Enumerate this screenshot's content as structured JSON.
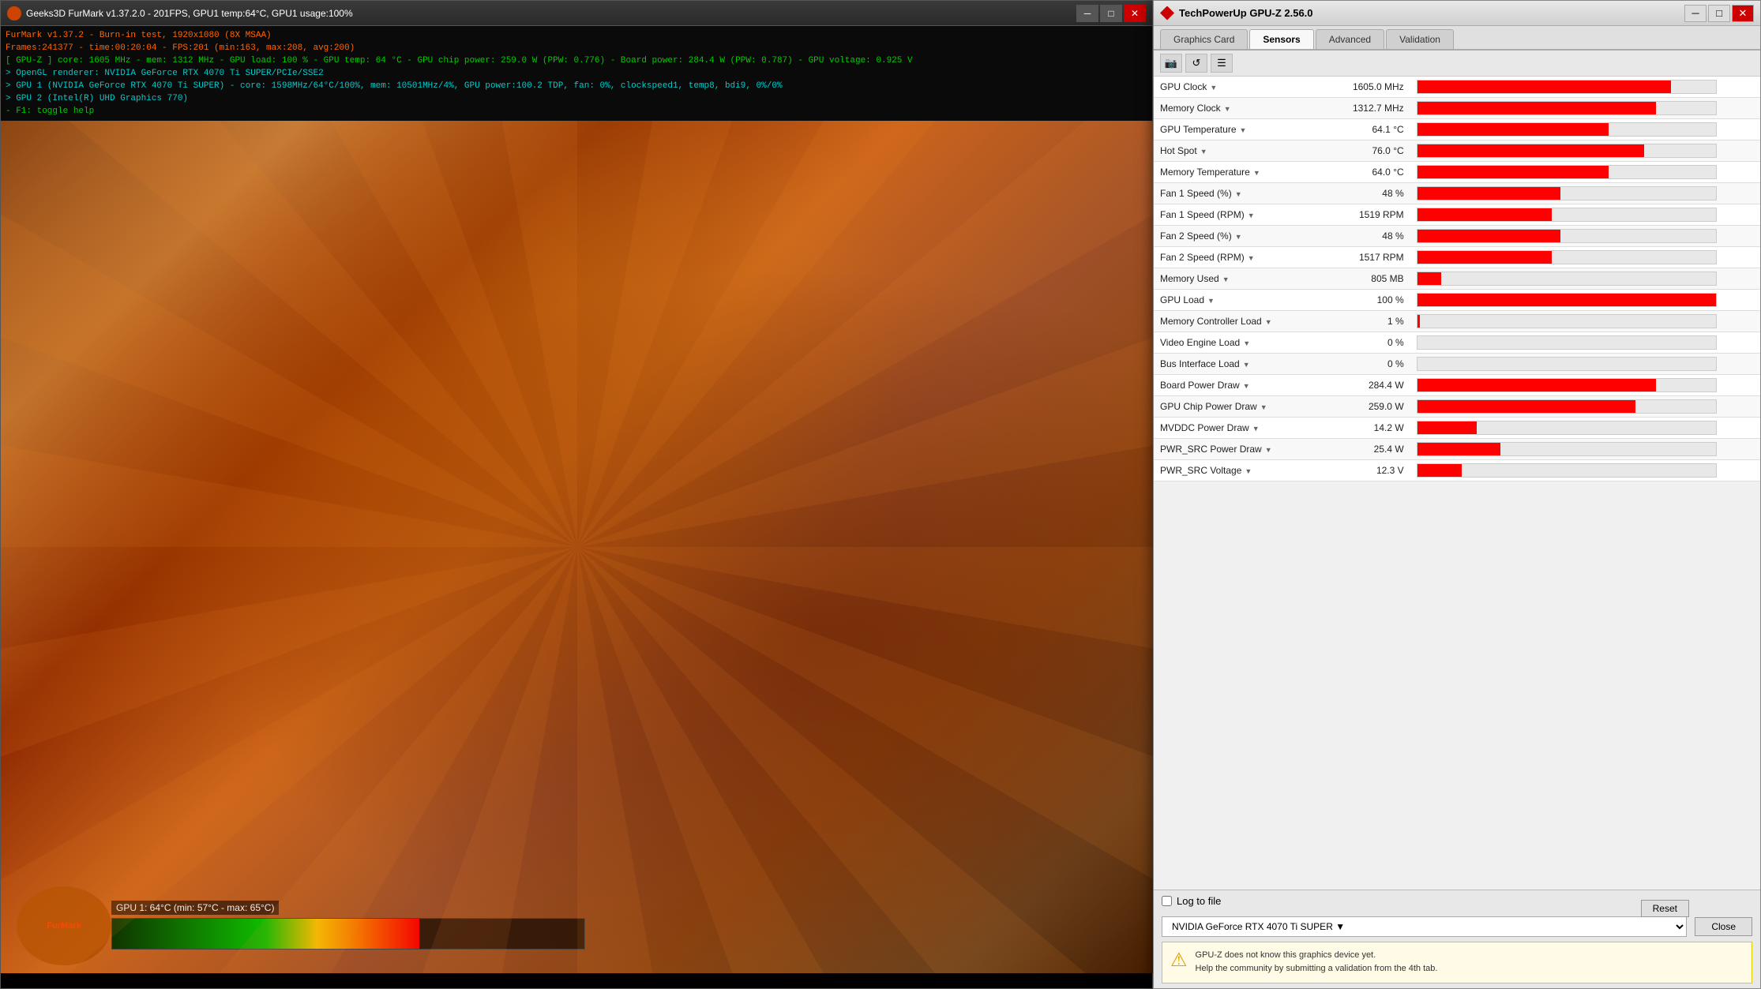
{
  "furmark": {
    "titlebar": {
      "title": "Geeks3D FurMark v1.37.2.0 - 201FPS, GPU1 temp:64°C, GPU1 usage:100%"
    },
    "info_lines": [
      "FurMark v1.37.2 - Burn-in test, 1920x1080 (8X MSAA)",
      "Frames:241377 - time:00:20:04 - FPS:201 (min:163, max:208, avg:200)",
      "[ GPU-Z ] core: 1605 MHz - mem: 1312 MHz - GPU load: 100 % - GPU temp: 64 °C - GPU chip power: 259.0 W (PPW: 0.776) - Board power: 284.4 W (PPW: 0.787) - GPU voltage: 0.925 V",
      "> OpenGL renderer: NVIDIA GeForce RTX 4070 Ti SUPER/PCIe/SSE2",
      "> GPU 1 (NVIDIA GeForce RTX 4070 Ti SUPER) - core: 1598MHz/64°C/100%, mem: 10501MHz/4%, GPU power:100.2 TDP, fan: 0%, clockspeed1, temp8, bdi9, 0%/0%",
      "> GPU 2 (Intel(R) UHD Graphics 770)",
      "- F1: toggle help"
    ],
    "overlay": {
      "temp_label": "GPU 1: 64°C (min: 57°C - max: 65°C)"
    }
  },
  "gpuz": {
    "titlebar": {
      "title": "TechPowerUp GPU-Z 2.56.0"
    },
    "tabs": [
      {
        "label": "Graphics Card",
        "active": false
      },
      {
        "label": "Sensors",
        "active": true
      },
      {
        "label": "Advanced",
        "active": false
      },
      {
        "label": "Validation",
        "active": false
      }
    ],
    "toolbar": {
      "icons": [
        "camera",
        "refresh",
        "menu"
      ]
    },
    "sensors": [
      {
        "name": "GPU Clock",
        "value": "1605.0 MHz",
        "bar_pct": 85
      },
      {
        "name": "Memory Clock",
        "value": "1312.7 MHz",
        "bar_pct": 80
      },
      {
        "name": "GPU Temperature",
        "value": "64.1 °C",
        "bar_pct": 64
      },
      {
        "name": "Hot Spot",
        "value": "76.0 °C",
        "bar_pct": 76
      },
      {
        "name": "Memory Temperature",
        "value": "64.0 °C",
        "bar_pct": 64
      },
      {
        "name": "Fan 1 Speed (%)",
        "value": "48 %",
        "bar_pct": 48
      },
      {
        "name": "Fan 1 Speed (RPM)",
        "value": "1519 RPM",
        "bar_pct": 45
      },
      {
        "name": "Fan 2 Speed (%)",
        "value": "48 %",
        "bar_pct": 48
      },
      {
        "name": "Fan 2 Speed (RPM)",
        "value": "1517 RPM",
        "bar_pct": 45
      },
      {
        "name": "Memory Used",
        "value": "805 MB",
        "bar_pct": 8
      },
      {
        "name": "GPU Load",
        "value": "100 %",
        "bar_pct": 100
      },
      {
        "name": "Memory Controller Load",
        "value": "1 %",
        "bar_pct": 1
      },
      {
        "name": "Video Engine Load",
        "value": "0 %",
        "bar_pct": 0
      },
      {
        "name": "Bus Interface Load",
        "value": "0 %",
        "bar_pct": 0
      },
      {
        "name": "Board Power Draw",
        "value": "284.4 W",
        "bar_pct": 80
      },
      {
        "name": "GPU Chip Power Draw",
        "value": "259.0 W",
        "bar_pct": 73
      },
      {
        "name": "MVDDC Power Draw",
        "value": "14.2 W",
        "bar_pct": 20
      },
      {
        "name": "PWR_SRC Power Draw",
        "value": "25.4 W",
        "bar_pct": 28
      },
      {
        "name": "PWR_SRC Voltage",
        "value": "12.3 V",
        "bar_pct": 15
      }
    ],
    "log_to_file": "Log to file",
    "reset_button": "Reset",
    "gpu_select": "NVIDIA GeForce RTX 4070 Ti SUPER",
    "close_button": "Close",
    "warning": {
      "message1": "GPU-Z does not know this graphics device yet.",
      "message2": "Help the community by submitting a validation from the 4th tab."
    }
  }
}
